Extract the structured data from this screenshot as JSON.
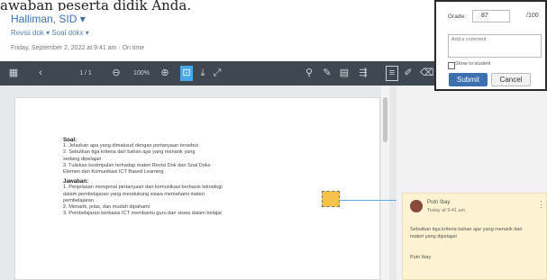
{
  "top_text": "awaban peserta didik Anda.",
  "student": {
    "name": "Halliman, SID",
    "caret": "▾"
  },
  "breadcrumb": {
    "item1": "Revisi dok",
    "sep": "▾",
    "item2": "Soal dokx",
    "caret": "▾"
  },
  "submitted": "Friday, September 2, 2022 at 9:41 am · On time",
  "toolbar": {
    "page": "1 / 1",
    "zoom": "100%"
  },
  "document": {
    "heading1": "Soal:",
    "q0": "1.   Jelaskan apa yang dimaksud dengan pertanyaan tersebut",
    "q1": "2.   Sebutkan tiga kriteria dari bahan ajar yang menarik yang",
    "q1b": "       sedang dipelajari",
    "q2": "3.   Tuliskan kesimpulan terhadap materi Revisi Dok dan Soal Dokx",
    "q2b": "       Elemen dan Komunikasi ICT Based Learning",
    "heading2": "Jawaban:",
    "a1": "1.   Penjelasan mengenai pertanyaan dan komunikasi berbasis teknologi",
    "a1b": "       dalam pembelajaran yang mendukung siswa memahami materi",
    "a1c": "       pembelajaran",
    "a2": "2.   Menarik, jelas, dan mudah dipahami",
    "a3": "3.   Pembelajaran berbasis ICT membantu guru dan siswa dalam belajar"
  },
  "comment": {
    "author": "Putri Ibay",
    "time": "Today at 9:41 am",
    "more": "⋮",
    "body": "Sebutkan tiga kriteria bahan ajar yang menarik dari materi yang dipelajari",
    "author_bottom": "Putri Ibay"
  },
  "grade": {
    "label": "Grade:",
    "value": "87",
    "max": "/100",
    "comment_placeholder": "Add a comment",
    "show_label": "Show to student",
    "submit_label": "Submit",
    "cancel_label": "Cancel"
  },
  "colors": {
    "toolbar_bg": "#3f4850",
    "accent": "#49a9e8",
    "link": "#3a6fb0",
    "pin": "#f5c34a"
  }
}
